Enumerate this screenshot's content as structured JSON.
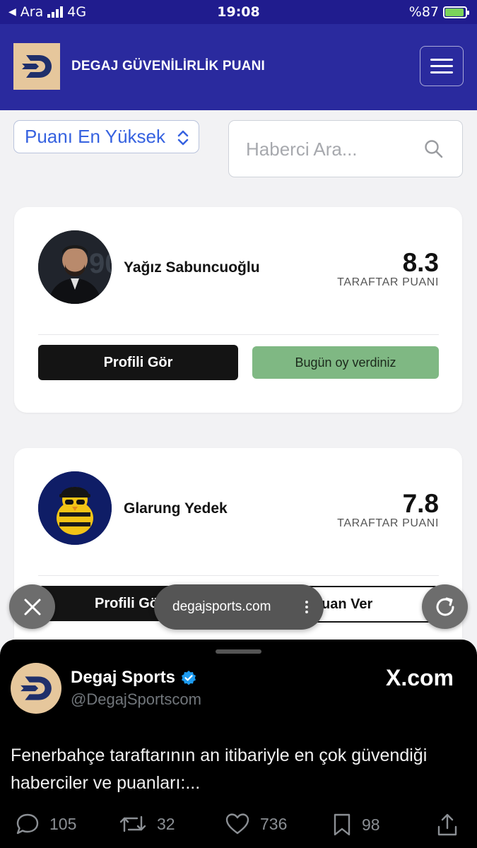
{
  "status_bar": {
    "back_label": "Ara",
    "network": "4G",
    "time": "19:08",
    "battery": "%87"
  },
  "header": {
    "site_title": "DEGAJ GÜVENİLİRLİK PUANI",
    "menu_icon": "hamburger-icon"
  },
  "filters": {
    "sort_value": "Puanı En Yüksek",
    "search_placeholder": "Haberci Ara..."
  },
  "cards": [
    {
      "name": "Yağız Sabuncuoğlu",
      "score": "8.3",
      "score_label": "TARAFTAR PUANI",
      "profile_button": "Profili Gör",
      "vote_status": "Bugün oy verdiniz"
    },
    {
      "name": "Glarung Yedek",
      "score": "7.8",
      "score_label": "TARAFTAR PUANI",
      "profile_button": "Profili Gö",
      "vote_button": "uan Ver"
    }
  ],
  "browser": {
    "url": "degajsports.com"
  },
  "tweet": {
    "display_name": "Degaj Sports",
    "handle": "@DegajSportscom",
    "source": "X.com",
    "text": "Fenerbahçe taraftarının an itibariyle en çok güvendiği haberciler ve puanları:...",
    "replies": "105",
    "reposts": "32",
    "likes": "736",
    "bookmarks": "98"
  },
  "colors": {
    "header_bg": "#2a2a9e",
    "accent_blue": "#3662e0",
    "voted_green": "#7fb883",
    "verified_blue": "#1d9bf0"
  }
}
